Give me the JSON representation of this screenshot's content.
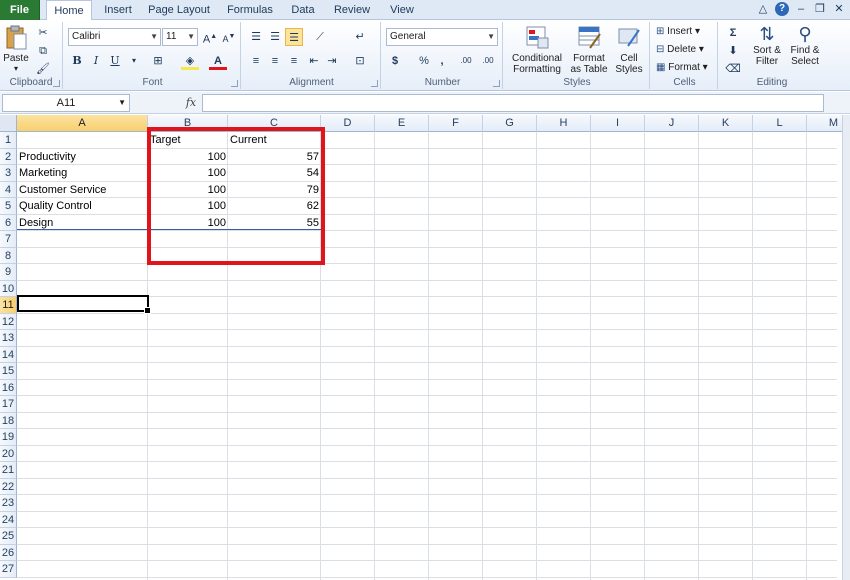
{
  "ribbon_tabs": [
    "File",
    "Home",
    "Insert",
    "Page Layout",
    "Formulas",
    "Data",
    "Review",
    "View"
  ],
  "ribbon": {
    "clipboard": {
      "label": "Clipboard",
      "paste": "Paste"
    },
    "font": {
      "label": "Font",
      "name": "Calibri",
      "size": "11",
      "bold": "B",
      "italic": "I",
      "underline": "U"
    },
    "alignment": {
      "label": "Alignment"
    },
    "number": {
      "label": "Number",
      "format": "General",
      "currency": "$",
      "percent": "%",
      "comma": ",",
      "inc_dec": ".00",
      "dec_dec": ".00"
    },
    "styles": {
      "label": "Styles",
      "conditional": "Conditional",
      "conditional2": "Formatting",
      "format_table": "Format",
      "format_table2": "as Table",
      "cell_styles": "Cell",
      "cell_styles2": "Styles"
    },
    "cells": {
      "label": "Cells",
      "insert": "Insert",
      "delete": "Delete",
      "format": "Format"
    },
    "editing": {
      "label": "Editing",
      "sort": "Sort &",
      "sort2": "Filter",
      "find": "Find &",
      "find2": "Select"
    }
  },
  "formula_bar": {
    "name_box": "A11",
    "fx": "fx",
    "value": ""
  },
  "columns": [
    "A",
    "B",
    "C",
    "D",
    "E",
    "F",
    "G",
    "H",
    "I",
    "J",
    "K",
    "L",
    "M"
  ],
  "rows": [
    "1",
    "2",
    "3",
    "4",
    "5",
    "6",
    "7",
    "8",
    "9",
    "10",
    "11",
    "12",
    "13",
    "14",
    "15",
    "16",
    "17",
    "18",
    "19",
    "20",
    "21",
    "22",
    "23",
    "24",
    "25",
    "26",
    "27"
  ],
  "selected_column": "A",
  "selected_row": "11",
  "sheet": {
    "headers": {
      "b": "Target",
      "c": "Current"
    },
    "data": [
      {
        "a": "Productivity",
        "b": "100",
        "c": "57"
      },
      {
        "a": "Marketing",
        "b": "100",
        "c": "54"
      },
      {
        "a": "Customer Service",
        "b": "100",
        "c": "79"
      },
      {
        "a": "Quality Control",
        "b": "100",
        "c": "62"
      },
      {
        "a": "Design",
        "b": "100",
        "c": "55"
      }
    ]
  },
  "colors": {
    "highlight_box": "#e1141c",
    "file_tab": "#2a7a34"
  }
}
